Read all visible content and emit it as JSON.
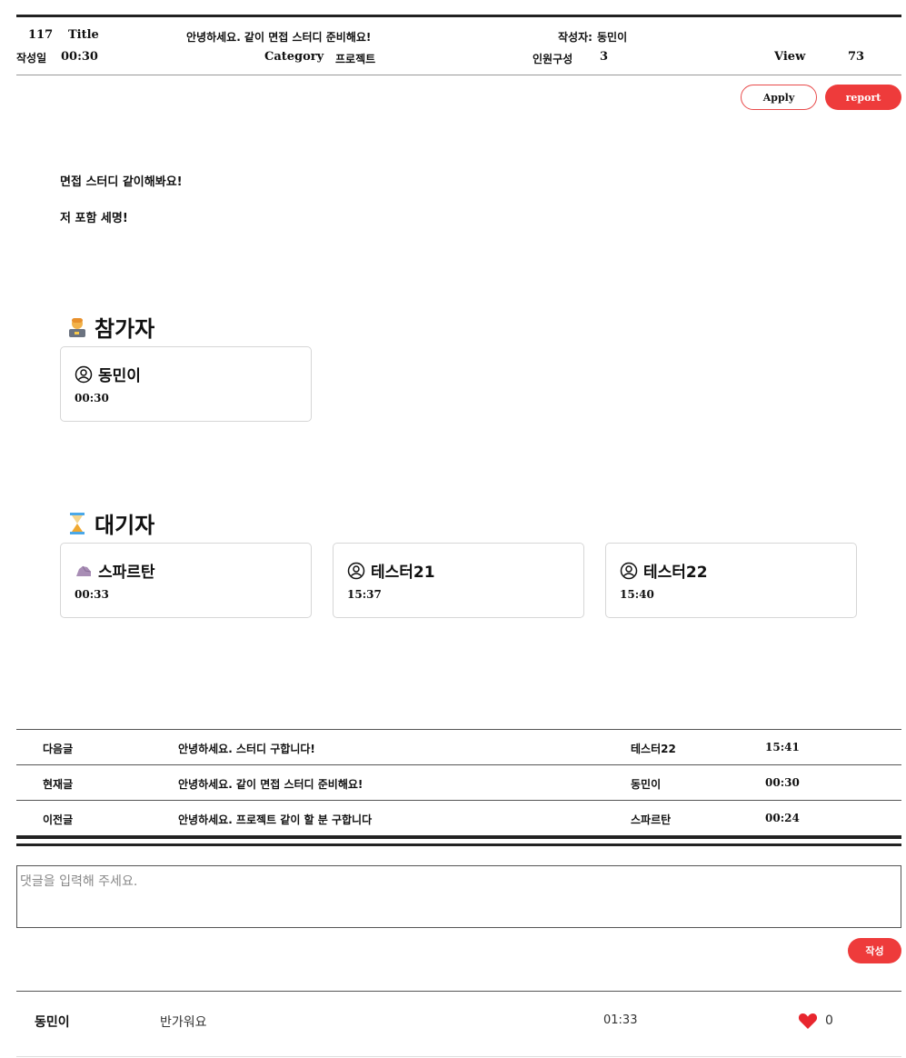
{
  "post": {
    "number": "117",
    "title_label": "Title",
    "title": "안녕하세요. 같이 면접 스터디 준비해요!",
    "author_label": "작성자:",
    "author": "동민이",
    "date_label": "작성일",
    "date": "00:30",
    "category_label": "Category",
    "category": "프로젝트",
    "members_label": "인원구성",
    "members": "3",
    "view_label": "View",
    "views": "73"
  },
  "actions": {
    "apply": "Apply",
    "report": "report"
  },
  "content": {
    "line1": "면접 스터디 같이해봐요!",
    "line2": "저 포함 세명!"
  },
  "participants": {
    "title": "참가자",
    "icon": "technologist-emoji",
    "items": [
      {
        "name": "동민이",
        "time": "00:30",
        "icon": "user-circle-icon"
      }
    ]
  },
  "waiting": {
    "title": "대기자",
    "icon": "hourglass-emoji",
    "items": [
      {
        "name": "스파르탄",
        "time": "00:33",
        "icon": "rock-avatar"
      },
      {
        "name": "테스터21",
        "time": "15:37",
        "icon": "user-circle-icon"
      },
      {
        "name": "테스터22",
        "time": "15:40",
        "icon": "user-circle-icon"
      }
    ]
  },
  "nav": [
    {
      "label": "다음글",
      "title": "안녕하세요. 스터디 구합니다!",
      "author": "테스터22",
      "time": "15:41"
    },
    {
      "label": "현재글",
      "title": "안녕하세요. 같이 면접 스터디 준비해요!",
      "author": "동민이",
      "time": "00:30"
    },
    {
      "label": "이전글",
      "title": "안녕하세요. 프로젝트 같이 할 분 구합니다",
      "author": "스파르탄",
      "time": "00:24"
    }
  ],
  "comment_form": {
    "placeholder": "댓글을 입력해 주세요.",
    "submit": "작성"
  },
  "comments": [
    {
      "author": "동민이",
      "text": "반가워요",
      "time": "01:33",
      "likes": "0"
    }
  ],
  "colors": {
    "accent": "#ee3b3b",
    "heart": "#e8262e"
  }
}
